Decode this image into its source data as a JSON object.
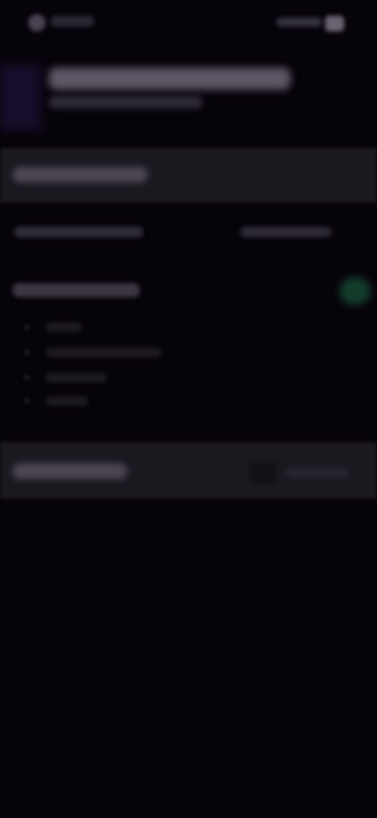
{
  "colors": {
    "background": "#07030a",
    "panel": "#1b1820",
    "toggle_on": "#133c2b",
    "header_accent": "#170d2a"
  },
  "icons": {
    "status_left": "app-icon",
    "status_right": "battery-icon",
    "toggle": "toggle-switch-icon"
  }
}
